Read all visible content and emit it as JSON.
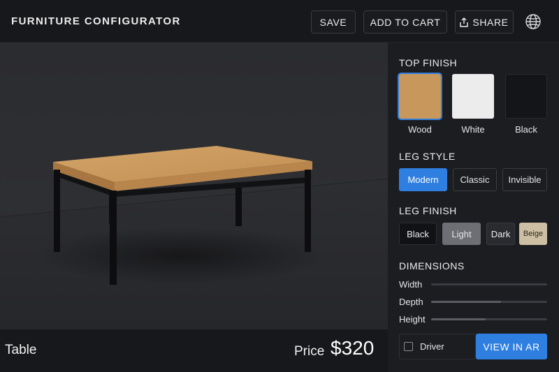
{
  "header": {
    "title": "FURNITURE CONFIGURATOR",
    "save_label": "SAVE",
    "cart_label": "ADD TO CART",
    "share_label": "SHARE"
  },
  "product": {
    "name": "Table",
    "price_label": "Price",
    "price_value": "$320"
  },
  "panel": {
    "top_finish": {
      "title": "TOP FINISH",
      "options": [
        {
          "label": "Wood",
          "color": "#c8975b",
          "selected": true
        },
        {
          "label": "White",
          "color": "#ececec",
          "selected": false
        },
        {
          "label": "Black",
          "color": "#141518",
          "selected": false
        }
      ]
    },
    "leg_style": {
      "title": "LEG STYLE",
      "options": [
        {
          "label": "Modern",
          "active": true
        },
        {
          "label": "Classic",
          "active": false
        },
        {
          "label": "Invisible",
          "active": false
        }
      ]
    },
    "leg_finish": {
      "title": "LEG FINISH",
      "options": [
        {
          "label": "Black",
          "color": "#111215"
        },
        {
          "label": "Light",
          "color": "#6d6f75"
        },
        {
          "label": "Dark",
          "color": "#2a2b2f"
        },
        {
          "label": "Beige",
          "color": "#cdbfa3"
        }
      ]
    },
    "dimensions": {
      "title": "DIMENSIONS",
      "sliders": [
        {
          "label": "Width",
          "value": 0.0
        },
        {
          "label": "Depth",
          "value": 0.6
        },
        {
          "label": "Height",
          "value": 0.47
        }
      ]
    },
    "driver_label": "Driver",
    "ar_label": "VIEW IN AR"
  },
  "colors": {
    "accent": "#2f7fe0",
    "wood_top": "#c8975b",
    "wood_edge": "#a9773f",
    "legs": "#0d0d0f"
  }
}
